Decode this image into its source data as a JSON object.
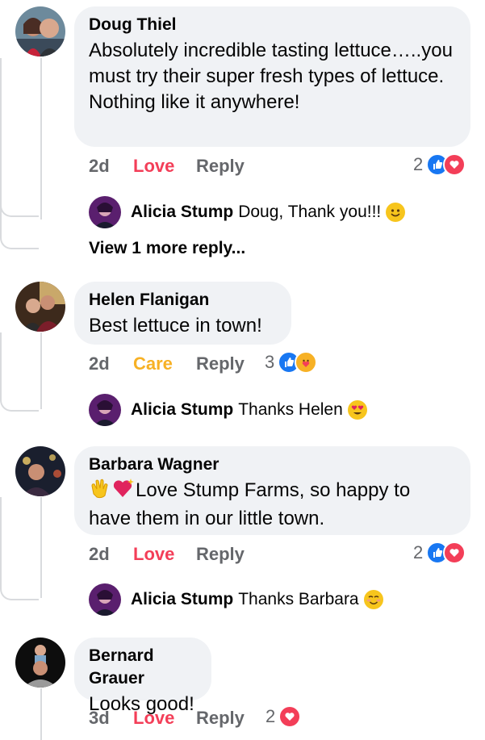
{
  "comments": [
    {
      "author": "Doug Thiel",
      "body": "Absolutely incredible tasting lettuce…..you must try their super fresh types of lettuce. Nothing like it anywhere!",
      "time": "2d",
      "reaction_label": "Love",
      "reply_label": "Reply",
      "reaction_count": "2",
      "reaction_icons": [
        "like-icon",
        "love-icon"
      ],
      "replies": [
        {
          "author": "Alicia Stump",
          "text": "Doug, Thank you!!!",
          "emoji": "slightly-smiling-face-icon"
        }
      ],
      "view_more": "View 1 more reply..."
    },
    {
      "author": "Helen Flanigan",
      "body": "Best lettuce in town!",
      "time": "2d",
      "reaction_label": "Care",
      "reply_label": "Reply",
      "reaction_count": "3",
      "reaction_icons": [
        "like-icon",
        "care-icon"
      ],
      "replies": [
        {
          "author": "Alicia Stump",
          "text": "Thanks Helen",
          "emoji": "heart-eyes-icon"
        }
      ]
    },
    {
      "author": "Barbara Wagner",
      "body": "Love Stump Farms, so happy to have them in our little town.",
      "body_emojis": [
        "clapping-hands-icon",
        "sparkling-heart-icon"
      ],
      "time": "2d",
      "reaction_label": "Love",
      "reply_label": "Reply",
      "reaction_count": "2",
      "reaction_icons": [
        "like-icon",
        "love-icon"
      ],
      "replies": [
        {
          "author": "Alicia Stump",
          "text": "Thanks Barbara",
          "emoji": "smiling-blush-icon"
        }
      ]
    },
    {
      "author": "Bernard Grauer",
      "body": "Looks good!",
      "time": "3d",
      "reaction_label": "Love",
      "reply_label": "Reply",
      "reaction_count": "2",
      "reaction_icons": [
        "love-icon"
      ]
    }
  ],
  "colors": {
    "bubble": "#f0f2f5",
    "love": "#f33e58",
    "care": "#f7b125",
    "like": "#1877f2",
    "meta": "#65676b"
  }
}
